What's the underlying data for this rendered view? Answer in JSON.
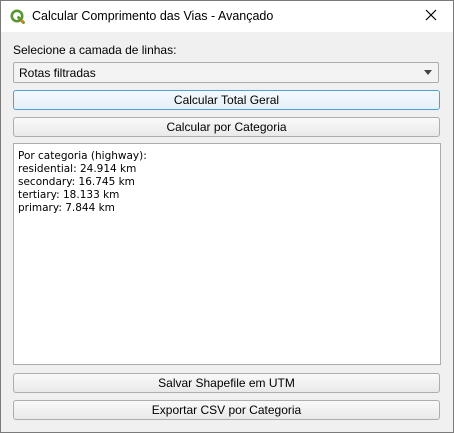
{
  "window": {
    "title": "Calcular Comprimento das Vias - Avançado",
    "app_icon": "qgis-logo-icon",
    "close_icon": "close-icon"
  },
  "layer_select": {
    "label": "Selecione a camada de linhas:",
    "selected": "Rotas filtradas"
  },
  "buttons": {
    "total": "Calcular Total Geral",
    "category": "Calcular por Categoria",
    "save_shapefile": "Salvar Shapefile em UTM",
    "export_csv": "Exportar CSV por Categoria"
  },
  "output": {
    "lines": [
      "Por categoria (highway):",
      "residential: 24.914 km",
      "secondary: 16.745 km",
      "tertiary: 18.133 km",
      "primary: 7.844 km"
    ]
  },
  "colors": {
    "accent": "#4aa0d8",
    "qgis_green": "#589632",
    "qgis_yellow": "#ee7913"
  }
}
